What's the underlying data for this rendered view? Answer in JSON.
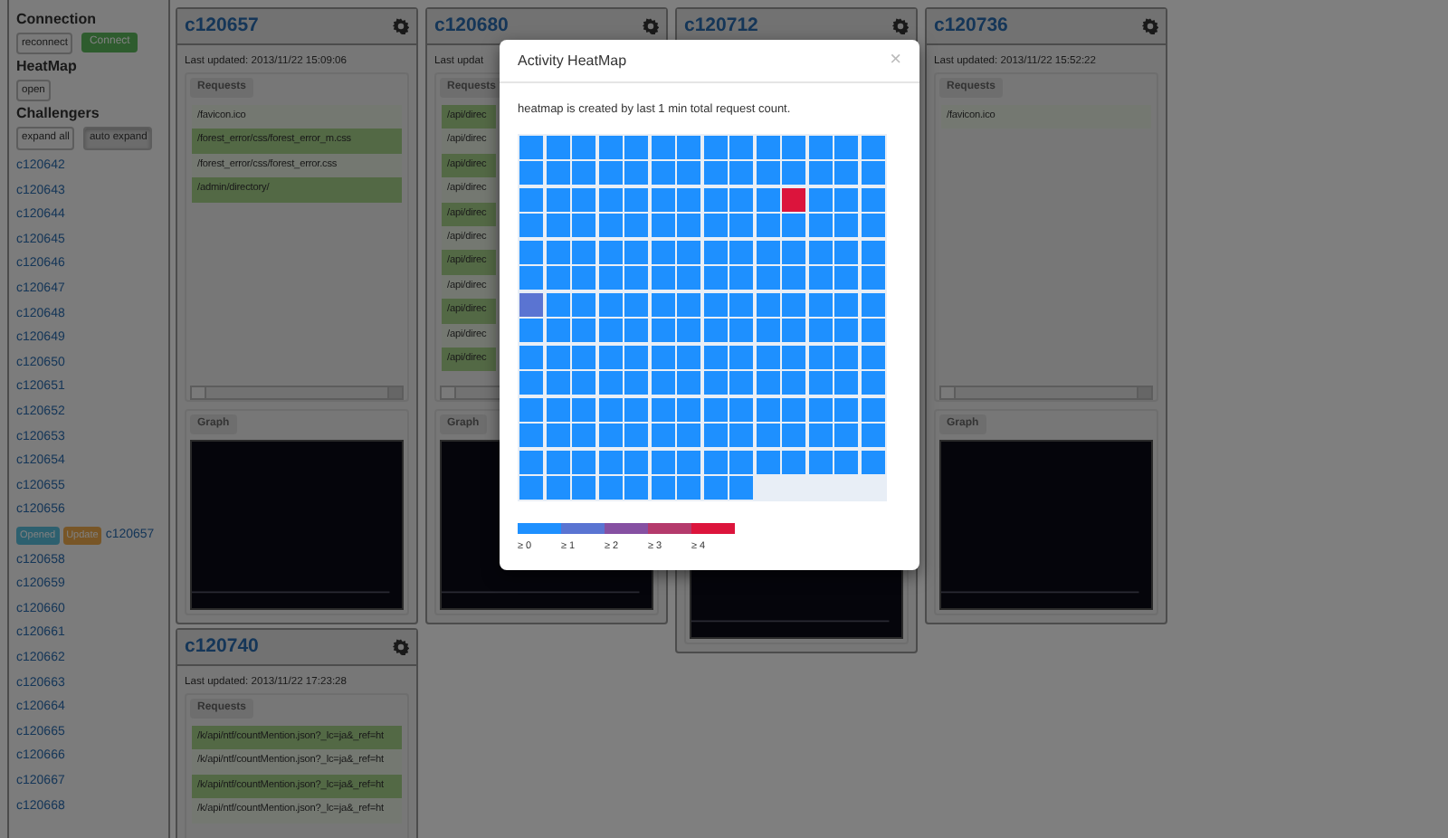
{
  "sidebar": {
    "connection": {
      "heading": "Connection",
      "reconnect_button": "reconnect",
      "status": "Connect"
    },
    "heatmap": {
      "heading": "HeatMap",
      "open_button": "open"
    },
    "challengers": {
      "heading": "Challengers",
      "expand_all_button": "expand all",
      "auto_expand_button": {
        "label": "auto expand",
        "on": true
      },
      "items": [
        {
          "name": "c120642"
        },
        {
          "name": "c120643"
        },
        {
          "name": "c120644"
        },
        {
          "name": "c120645"
        },
        {
          "name": "c120646"
        },
        {
          "name": "c120647"
        },
        {
          "name": "c120648"
        },
        {
          "name": "c120649"
        },
        {
          "name": "c120650"
        },
        {
          "name": "c120651"
        },
        {
          "name": "c120652"
        },
        {
          "name": "c120653"
        },
        {
          "name": "c120654"
        },
        {
          "name": "c120655"
        },
        {
          "name": "c120656"
        },
        {
          "name": "c120657",
          "badges": [
            {
              "label": "Opened",
              "kind": "info"
            },
            {
              "label": "Update",
              "kind": "warning"
            }
          ]
        },
        {
          "name": "c120658"
        },
        {
          "name": "c120659"
        },
        {
          "name": "c120660"
        },
        {
          "name": "c120661"
        },
        {
          "name": "c120662"
        },
        {
          "name": "c120663"
        },
        {
          "name": "c120664"
        },
        {
          "name": "c120665"
        },
        {
          "name": "c120666"
        },
        {
          "name": "c120667"
        },
        {
          "name": "c120668"
        }
      ]
    }
  },
  "columns": [
    {
      "panels": [
        {
          "title": "c120657",
          "last_updated": "Last updated: 2013/11/22 15:09:06",
          "requests_tab": "Requests",
          "requests": [
            {
              "path": "/favicon.ico",
              "highlighted": false
            },
            {
              "path": "/forest_error/css/forest_error_m.css",
              "highlighted": true
            },
            {
              "path": "/forest_error/css/forest_error.css",
              "highlighted": false
            },
            {
              "path": "/admin/directory/",
              "highlighted": true
            }
          ],
          "graph_tab": "Graph"
        },
        {
          "title": "c120740",
          "last_updated": "Last updated: 2013/11/22 17:23:28",
          "requests_tab": "Requests",
          "requests": [
            {
              "path": "/k/api/ntf/countMention.json?_lc=ja&_ref=ht",
              "highlighted": true
            },
            {
              "path": "/k/api/ntf/countMention.json?_lc=ja&_ref=ht",
              "highlighted": false
            },
            {
              "path": "/k/api/ntf/countMention.json?_lc=ja&_ref=ht",
              "highlighted": true
            },
            {
              "path": "/k/api/ntf/countMention.json?_lc=ja&_ref=ht",
              "highlighted": false
            }
          ]
        }
      ]
    },
    {
      "panels": [
        {
          "title": "c120680",
          "last_updated": "Last updat",
          "requests_tab": "Requests",
          "requests": [
            {
              "path": "/api/direc",
              "highlighted": true
            },
            {
              "path": "/api/direc",
              "highlighted": false
            },
            {
              "path": "/api/direc",
              "highlighted": true
            },
            {
              "path": "/api/direc",
              "highlighted": false
            },
            {
              "path": "/api/direc",
              "highlighted": true
            },
            {
              "path": "/api/direc",
              "highlighted": false
            },
            {
              "path": "/api/direc",
              "highlighted": true
            },
            {
              "path": "/api/direc",
              "highlighted": false
            },
            {
              "path": "/api/direc",
              "highlighted": true
            },
            {
              "path": "/api/direc",
              "highlighted": false
            },
            {
              "path": "/api/direc",
              "highlighted": true
            }
          ],
          "graph_tab": "Graph"
        }
      ]
    },
    {
      "panels": [
        {
          "title": "c120712"
        }
      ]
    },
    {
      "panels": [
        {
          "title": "c120736",
          "last_updated": "Last updated: 2013/11/22 15:52:22",
          "requests_tab": "Requests",
          "requests": [
            {
              "path": "/favicon.ico",
              "highlighted": false
            }
          ],
          "graph_tab": "Graph"
        }
      ]
    }
  ],
  "modal": {
    "title": "Activity HeatMap",
    "close": "×",
    "description": "heatmap is created by last 1 min total request count.",
    "cells": [
      {
        "color": "#1e90ff"
      },
      {
        "color": "#1e90ff"
      },
      {
        "color": "#1e90ff"
      },
      {
        "color": "#1e90ff"
      },
      {
        "color": "#1e90ff"
      },
      {
        "color": "#1e90ff"
      },
      {
        "color": "#1e90ff"
      },
      {
        "color": "#1e90ff"
      },
      {
        "color": "#1e90ff"
      },
      {
        "color": "#1e90ff"
      },
      {
        "color": "#1e90ff"
      },
      {
        "color": "#1e90ff"
      },
      {
        "color": "#1e90ff"
      },
      {
        "color": "#1e90ff"
      },
      {
        "color": "#1e90ff"
      },
      {
        "color": "#1e90ff"
      },
      {
        "color": "#1e90ff"
      },
      {
        "color": "#1e90ff"
      },
      {
        "color": "#1e90ff"
      },
      {
        "color": "#1e90ff"
      },
      {
        "color": "#1e90ff"
      },
      {
        "color": "#1e90ff"
      },
      {
        "color": "#1e90ff"
      },
      {
        "color": "#1e90ff"
      },
      {
        "color": "#1e90ff"
      },
      {
        "color": "#1e90ff"
      },
      {
        "color": "#1e90ff"
      },
      {
        "color": "#1e90ff"
      },
      {
        "color": "#1e90ff"
      },
      {
        "color": "#1e90ff"
      },
      {
        "color": "#1e90ff"
      },
      {
        "color": "#1e90ff"
      },
      {
        "color": "#1e90ff"
      },
      {
        "color": "#1e90ff"
      },
      {
        "color": "#1e90ff"
      },
      {
        "color": "#1e90ff"
      },
      {
        "color": "#1e90ff"
      },
      {
        "color": "#1e90ff"
      },
      {
        "color": "#dc143c"
      },
      {
        "color": "#1e90ff"
      },
      {
        "color": "#1e90ff"
      },
      {
        "color": "#1e90ff"
      },
      {
        "color": "#1e90ff"
      },
      {
        "color": "#1e90ff"
      },
      {
        "color": "#1e90ff"
      },
      {
        "color": "#1e90ff"
      },
      {
        "color": "#1e90ff"
      },
      {
        "color": "#1e90ff"
      },
      {
        "color": "#1e90ff"
      },
      {
        "color": "#1e90ff"
      },
      {
        "color": "#1e90ff"
      },
      {
        "color": "#1e90ff"
      },
      {
        "color": "#1e90ff"
      },
      {
        "color": "#1e90ff"
      },
      {
        "color": "#1e90ff"
      },
      {
        "color": "#1e90ff"
      },
      {
        "color": "#1e90ff"
      },
      {
        "color": "#1e90ff"
      },
      {
        "color": "#1e90ff"
      },
      {
        "color": "#1e90ff"
      },
      {
        "color": "#1e90ff"
      },
      {
        "color": "#1e90ff"
      },
      {
        "color": "#1e90ff"
      },
      {
        "color": "#1e90ff"
      },
      {
        "color": "#1e90ff"
      },
      {
        "color": "#1e90ff"
      },
      {
        "color": "#1e90ff"
      },
      {
        "color": "#1e90ff"
      },
      {
        "color": "#1e90ff"
      },
      {
        "color": "#1e90ff"
      },
      {
        "color": "#1e90ff"
      },
      {
        "color": "#1e90ff"
      },
      {
        "color": "#1e90ff"
      },
      {
        "color": "#1e90ff"
      },
      {
        "color": "#1e90ff"
      },
      {
        "color": "#1e90ff"
      },
      {
        "color": "#1e90ff"
      },
      {
        "color": "#1e90ff"
      },
      {
        "color": "#1e90ff"
      },
      {
        "color": "#1e90ff"
      },
      {
        "color": "#1e90ff"
      },
      {
        "color": "#1e90ff"
      },
      {
        "color": "#1e90ff"
      },
      {
        "color": "#1e90ff"
      },
      {
        "color": "#5a74d2"
      },
      {
        "color": "#1e90ff"
      },
      {
        "color": "#1e90ff"
      },
      {
        "color": "#1e90ff"
      },
      {
        "color": "#1e90ff"
      },
      {
        "color": "#1e90ff"
      },
      {
        "color": "#1e90ff"
      },
      {
        "color": "#1e90ff"
      },
      {
        "color": "#1e90ff"
      },
      {
        "color": "#1e90ff"
      },
      {
        "color": "#1e90ff"
      },
      {
        "color": "#1e90ff"
      },
      {
        "color": "#1e90ff"
      },
      {
        "color": "#1e90ff"
      },
      {
        "color": "#1e90ff"
      },
      {
        "color": "#1e90ff"
      },
      {
        "color": "#1e90ff"
      },
      {
        "color": "#1e90ff"
      },
      {
        "color": "#1e90ff"
      },
      {
        "color": "#1e90ff"
      },
      {
        "color": "#1e90ff"
      },
      {
        "color": "#1e90ff"
      },
      {
        "color": "#1e90ff"
      },
      {
        "color": "#1e90ff"
      },
      {
        "color": "#1e90ff"
      },
      {
        "color": "#1e90ff"
      },
      {
        "color": "#1e90ff"
      },
      {
        "color": "#1e90ff"
      },
      {
        "color": "#1e90ff"
      },
      {
        "color": "#1e90ff"
      },
      {
        "color": "#1e90ff"
      },
      {
        "color": "#1e90ff"
      },
      {
        "color": "#1e90ff"
      },
      {
        "color": "#1e90ff"
      },
      {
        "color": "#1e90ff"
      },
      {
        "color": "#1e90ff"
      },
      {
        "color": "#1e90ff"
      },
      {
        "color": "#1e90ff"
      },
      {
        "color": "#1e90ff"
      },
      {
        "color": "#1e90ff"
      },
      {
        "color": "#1e90ff"
      },
      {
        "color": "#1e90ff"
      },
      {
        "color": "#1e90ff"
      },
      {
        "color": "#1e90ff"
      },
      {
        "color": "#1e90ff"
      },
      {
        "color": "#1e90ff"
      },
      {
        "color": "#1e90ff"
      },
      {
        "color": "#1e90ff"
      },
      {
        "color": "#1e90ff"
      },
      {
        "color": "#1e90ff"
      },
      {
        "color": "#1e90ff"
      },
      {
        "color": "#1e90ff"
      },
      {
        "color": "#1e90ff"
      },
      {
        "color": "#1e90ff"
      },
      {
        "color": "#1e90ff"
      },
      {
        "color": "#1e90ff"
      },
      {
        "color": "#1e90ff"
      },
      {
        "color": "#1e90ff"
      },
      {
        "color": "#1e90ff"
      },
      {
        "color": "#1e90ff"
      },
      {
        "color": "#1e90ff"
      },
      {
        "color": "#1e90ff"
      },
      {
        "color": "#1e90ff"
      },
      {
        "color": "#1e90ff"
      },
      {
        "color": "#1e90ff"
      },
      {
        "color": "#1e90ff"
      },
      {
        "color": "#1e90ff"
      },
      {
        "color": "#1e90ff"
      },
      {
        "color": "#1e90ff"
      },
      {
        "color": "#1e90ff"
      },
      {
        "color": "#1e90ff"
      },
      {
        "color": "#1e90ff"
      },
      {
        "color": "#1e90ff"
      },
      {
        "color": "#1e90ff"
      },
      {
        "color": "#1e90ff"
      },
      {
        "color": "#1e90ff"
      },
      {
        "color": "#1e90ff"
      },
      {
        "color": "#1e90ff"
      },
      {
        "color": "#1e90ff"
      },
      {
        "color": "#1e90ff"
      },
      {
        "color": "#1e90ff"
      },
      {
        "color": "#1e90ff"
      },
      {
        "color": "#1e90ff"
      },
      {
        "color": "#1e90ff"
      },
      {
        "color": "#1e90ff"
      },
      {
        "color": "#1e90ff"
      },
      {
        "color": "#1e90ff"
      },
      {
        "color": "#1e90ff"
      },
      {
        "color": "#1e90ff"
      },
      {
        "color": "#1e90ff"
      },
      {
        "color": "#1e90ff"
      },
      {
        "color": "#1e90ff"
      },
      {
        "color": "#1e90ff"
      },
      {
        "color": "#1e90ff"
      },
      {
        "color": "#1e90ff"
      },
      {
        "color": "#1e90ff"
      },
      {
        "color": "#1e90ff"
      },
      {
        "color": "#1e90ff"
      },
      {
        "color": "#1e90ff"
      },
      {
        "color": "#1e90ff"
      },
      {
        "color": "#1e90ff"
      },
      {
        "color": "#1e90ff"
      },
      {
        "color": "#1e90ff"
      },
      {
        "color": "#1e90ff"
      },
      {
        "color": "#1e90ff"
      },
      {
        "color": "#1e90ff"
      },
      {
        "color": "#1e90ff"
      }
    ],
    "legend": [
      {
        "label": "≥ 0",
        "color": "#1e90ff"
      },
      {
        "label": "≥ 1",
        "color": "#5a74d2"
      },
      {
        "label": "≥ 2",
        "color": "#8650a2"
      },
      {
        "label": "≥ 3",
        "color": "#b43a6c"
      },
      {
        "label": "≥ 4",
        "color": "#dc143c"
      }
    ]
  }
}
